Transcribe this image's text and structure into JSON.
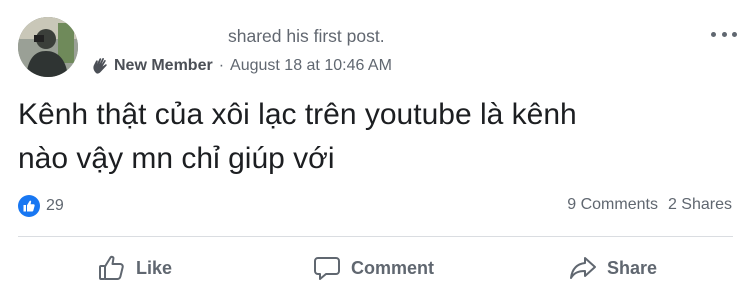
{
  "post": {
    "header_text": "shared his first post.",
    "badge": "New Member",
    "separator": "·",
    "timestamp": "August 18 at 10:46 AM",
    "more_icon": "more-options-icon",
    "text_line1": "Kênh thật của xôi lạc trên youtube là kênh",
    "text_line2": "nào vậy mn chỉ giúp với"
  },
  "stats": {
    "like_count": "29",
    "comments": "9 Comments",
    "shares": "2 Shares"
  },
  "actions": {
    "like_label": "Like",
    "comment_label": "Comment",
    "share_label": "Share"
  },
  "colors": {
    "accent": "#1877f2",
    "secondary_text": "#606770",
    "primary_text": "#1c1e21",
    "divider": "#dadde1"
  }
}
